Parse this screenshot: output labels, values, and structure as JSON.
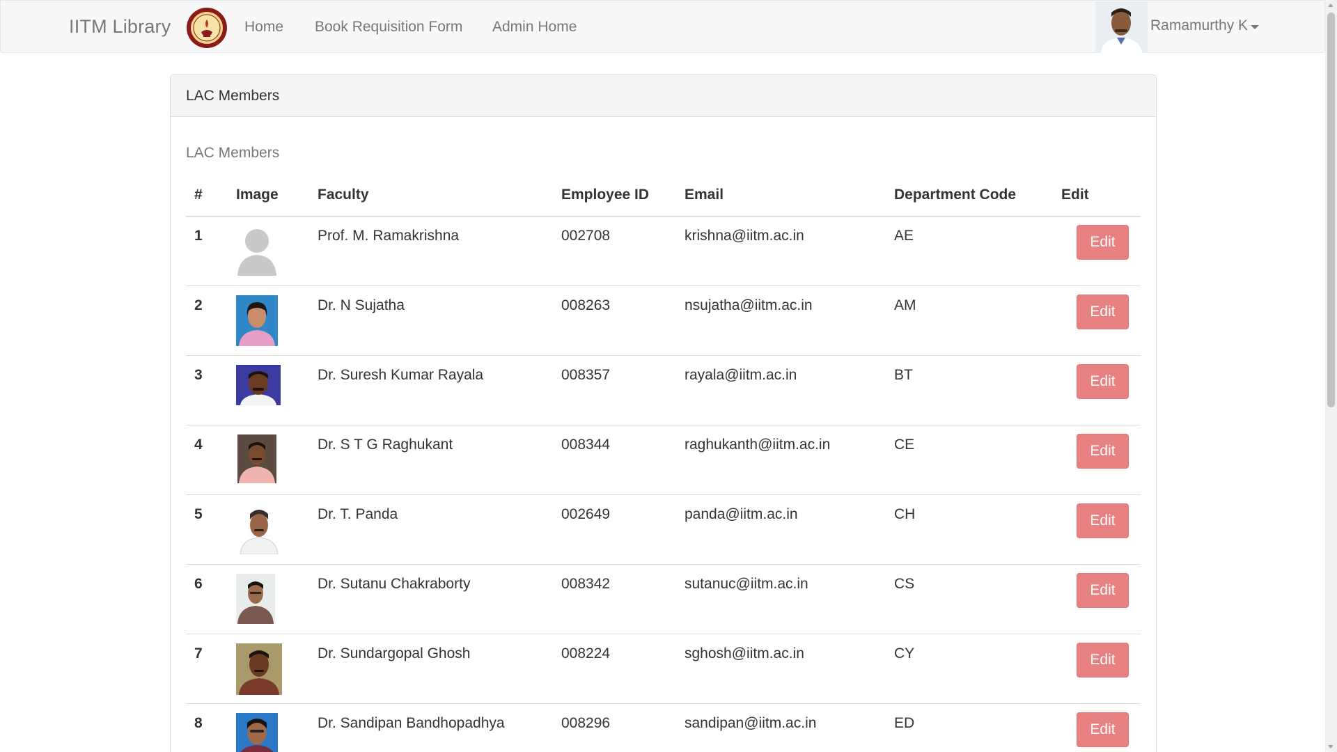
{
  "navbar": {
    "brand": "IITM Library",
    "logo_icon": "iitm-seal-logo",
    "links": [
      "Home",
      "Book Requisition Form",
      "Admin Home"
    ],
    "user_name": "Ramamurthy K",
    "user_photo_icon": "user-avatar"
  },
  "panel": {
    "heading": "LAC Members",
    "caption": "LAC Members"
  },
  "table": {
    "columns": [
      "#",
      "Image",
      "Faculty",
      "Employee ID",
      "Email",
      "Department Code",
      "Edit"
    ],
    "edit_label": "Edit",
    "rows": [
      {
        "num": "1",
        "faculty": "Prof. M. Ramakrishna",
        "emp_id": "002708",
        "email": "krishna@iitm.ac.in",
        "dept": "AE",
        "image": "no-photo-placeholder"
      },
      {
        "num": "2",
        "faculty": "Dr. N Sujatha",
        "emp_id": "008263",
        "email": "nsujatha@iitm.ac.in",
        "dept": "AM",
        "image": "faculty-photo"
      },
      {
        "num": "3",
        "faculty": "Dr. Suresh Kumar Rayala",
        "emp_id": "008357",
        "email": "rayala@iitm.ac.in",
        "dept": "BT",
        "image": "faculty-photo"
      },
      {
        "num": "4",
        "faculty": "Dr. S T G Raghukant",
        "emp_id": "008344",
        "email": "raghukanth@iitm.ac.in",
        "dept": "CE",
        "image": "faculty-photo"
      },
      {
        "num": "5",
        "faculty": "Dr. T. Panda",
        "emp_id": "002649",
        "email": "panda@iitm.ac.in",
        "dept": "CH",
        "image": "faculty-photo"
      },
      {
        "num": "6",
        "faculty": "Dr. Sutanu Chakraborty",
        "emp_id": "008342",
        "email": "sutanuc@iitm.ac.in",
        "dept": "CS",
        "image": "faculty-photo"
      },
      {
        "num": "7",
        "faculty": "Dr. Sundargopal Ghosh",
        "emp_id": "008224",
        "email": "sghosh@iitm.ac.in",
        "dept": "CY",
        "image": "faculty-photo"
      },
      {
        "num": "8",
        "faculty": "Dr. Sandipan Bandhopadhya",
        "emp_id": "008296",
        "email": "sandipan@iitm.ac.in",
        "dept": "ED",
        "image": "faculty-photo"
      }
    ]
  },
  "colors": {
    "navbar_bg": "#f8f8f8",
    "panel_heading_bg": "#f5f5f5",
    "edit_button": "#e88282",
    "nav_text": "#777777"
  }
}
